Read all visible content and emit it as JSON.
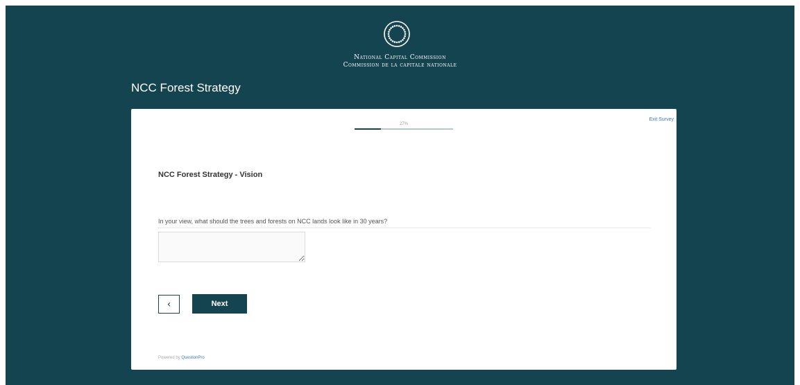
{
  "header": {
    "org_name_en": "National Capital Commission",
    "org_name_fr": "Commission de la capitale nationale",
    "survey_title": "NCC Forest Strategy",
    "logo_icon": "ncc-circle-logo-icon"
  },
  "progress": {
    "percent": 27,
    "label": "27%"
  },
  "exit_label": "Exit Survey",
  "section": {
    "title": "NCC Forest Strategy - Vision"
  },
  "question": {
    "text": "In your view, what should the trees and forests on NCC lands look like in 30 years?",
    "answer_value": ""
  },
  "nav": {
    "back_icon": "chevron-left-icon",
    "back_glyph": "‹",
    "next_label": "Next"
  },
  "footer": {
    "powered_prefix": "Powered by",
    "powered_brand": "QuestionPro"
  },
  "colors": {
    "brand": "#154451",
    "link": "#3c78c3"
  }
}
